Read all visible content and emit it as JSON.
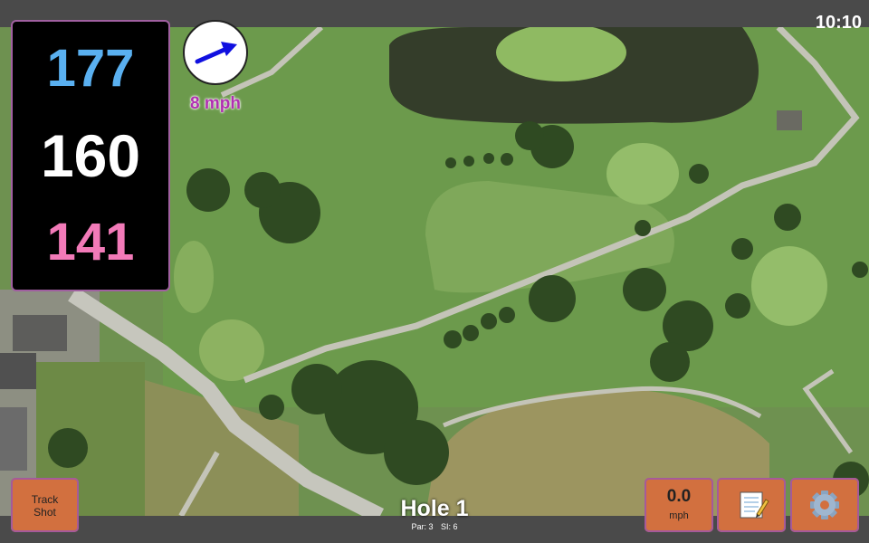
{
  "status": {
    "time": "10:10"
  },
  "distances": {
    "back": "177",
    "middle": "160",
    "front": "141",
    "colors": {
      "back": "#5ab0f0",
      "middle": "#ffffff",
      "front": "#f27ab8"
    }
  },
  "wind": {
    "speed_label": "8 mph",
    "arrow_icon": "wind-direction-arrow-icon",
    "color": "#1010e0",
    "label_color": "#b030b0"
  },
  "track_shot": {
    "line1": "Track",
    "line2": "Shot"
  },
  "shot_speed": {
    "value": "0.0",
    "unit": "mph"
  },
  "notes_button": {
    "icon": "notepad-icon"
  },
  "settings_button": {
    "icon": "gear-icon"
  },
  "hole": {
    "title": "Hole 1",
    "par": "Par: 3",
    "si": "SI: 6"
  },
  "theme": {
    "button_color": "#d2703f",
    "accent": "#a55a9a"
  }
}
